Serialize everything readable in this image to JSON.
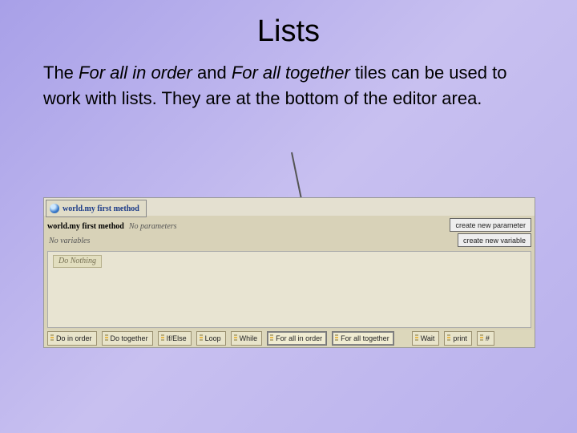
{
  "title": "Lists",
  "para": {
    "p1a": "The ",
    "p1i": "For all in order",
    "p1b": " and ",
    "p1j": "For all together",
    "p1c": " tiles can be used to work with lists.  They are at the bottom of the editor area."
  },
  "editor": {
    "tab_label": "world.my first method",
    "sig_name": "world.my first method",
    "sig_noparams": "No parameters",
    "btn_new_param": "create new parameter",
    "btn_new_var": "create new variable",
    "no_variables": "No variables",
    "do_nothing": "Do Nothing"
  },
  "tiles": [
    "Do in order",
    "Do together",
    "If/Else",
    "Loop",
    "While",
    "For all in order",
    "For all together",
    "Wait",
    "print",
    "#"
  ],
  "highlight_indices": [
    5,
    6
  ]
}
